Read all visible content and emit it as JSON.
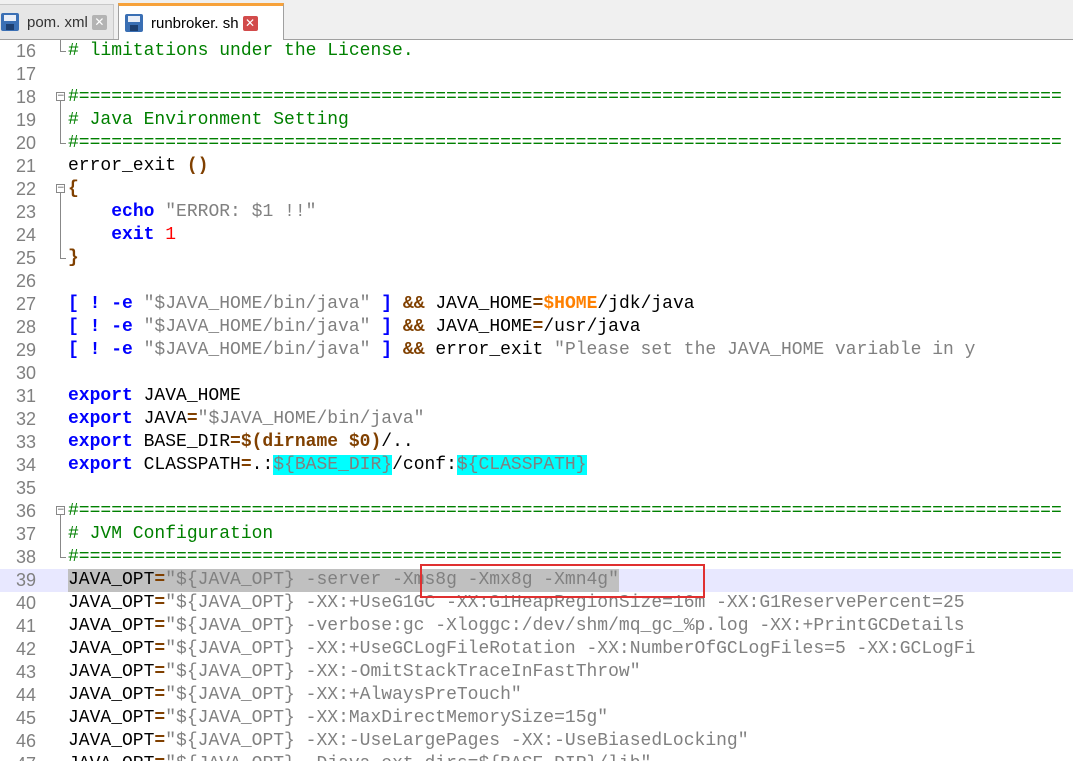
{
  "tabs": [
    {
      "label": "pom. xml",
      "close": "✕",
      "active": false
    },
    {
      "label": "runbroker. sh",
      "close": "✕",
      "active": true
    }
  ],
  "lines": [
    {
      "n": "16",
      "fold": "end",
      "segs": [
        {
          "t": "# limitations under the License.",
          "c": "c-com"
        }
      ]
    },
    {
      "n": "17",
      "fold": "",
      "segs": []
    },
    {
      "n": "18",
      "fold": "start",
      "segs": [
        {
          "t": "#===========================================================================================",
          "c": "c-com"
        }
      ]
    },
    {
      "n": "19",
      "fold": "mid",
      "segs": [
        {
          "t": "# Java Environment Setting",
          "c": "c-com"
        }
      ]
    },
    {
      "n": "20",
      "fold": "end",
      "segs": [
        {
          "t": "#===========================================================================================",
          "c": "c-com"
        }
      ]
    },
    {
      "n": "21",
      "fold": "",
      "segs": [
        {
          "t": "error_exit ",
          "c": "c-plain"
        },
        {
          "t": "()",
          "c": "c-op"
        }
      ]
    },
    {
      "n": "22",
      "fold": "start",
      "segs": [
        {
          "t": "{",
          "c": "c-op"
        }
      ]
    },
    {
      "n": "23",
      "fold": "mid",
      "segs": [
        {
          "t": "    ",
          "c": "c-plain"
        },
        {
          "t": "echo",
          "c": "c-kw"
        },
        {
          "t": " ",
          "c": "c-plain"
        },
        {
          "t": "\"ERROR: $1 !!\"",
          "c": "c-str"
        }
      ]
    },
    {
      "n": "24",
      "fold": "mid",
      "segs": [
        {
          "t": "    ",
          "c": "c-plain"
        },
        {
          "t": "exit",
          "c": "c-kw"
        },
        {
          "t": " ",
          "c": "c-plain"
        },
        {
          "t": "1",
          "c": "c-num"
        }
      ]
    },
    {
      "n": "25",
      "fold": "end",
      "segs": [
        {
          "t": "}",
          "c": "c-op"
        }
      ]
    },
    {
      "n": "26",
      "fold": "",
      "segs": []
    },
    {
      "n": "27",
      "fold": "",
      "segs": [
        {
          "t": "[ ! -e",
          "c": "c-kw"
        },
        {
          "t": " ",
          "c": "c-plain"
        },
        {
          "t": "\"$JAVA_HOME/bin/java\"",
          "c": "c-str"
        },
        {
          "t": " ",
          "c": "c-plain"
        },
        {
          "t": "]",
          "c": "c-kw"
        },
        {
          "t": " ",
          "c": "c-plain"
        },
        {
          "t": "&&",
          "c": "c-op"
        },
        {
          "t": " JAVA_HOME",
          "c": "c-plain"
        },
        {
          "t": "=",
          "c": "c-op"
        },
        {
          "t": "$HOME",
          "c": "c-var"
        },
        {
          "t": "/jdk/java",
          "c": "c-plain"
        }
      ]
    },
    {
      "n": "28",
      "fold": "",
      "segs": [
        {
          "t": "[ ! -e",
          "c": "c-kw"
        },
        {
          "t": " ",
          "c": "c-plain"
        },
        {
          "t": "\"$JAVA_HOME/bin/java\"",
          "c": "c-str"
        },
        {
          "t": " ",
          "c": "c-plain"
        },
        {
          "t": "]",
          "c": "c-kw"
        },
        {
          "t": " ",
          "c": "c-plain"
        },
        {
          "t": "&&",
          "c": "c-op"
        },
        {
          "t": " JAVA_HOME",
          "c": "c-plain"
        },
        {
          "t": "=",
          "c": "c-op"
        },
        {
          "t": "/usr/java",
          "c": "c-plain"
        }
      ]
    },
    {
      "n": "29",
      "fold": "",
      "segs": [
        {
          "t": "[ ! -e",
          "c": "c-kw"
        },
        {
          "t": " ",
          "c": "c-plain"
        },
        {
          "t": "\"$JAVA_HOME/bin/java\"",
          "c": "c-str"
        },
        {
          "t": " ",
          "c": "c-plain"
        },
        {
          "t": "]",
          "c": "c-kw"
        },
        {
          "t": " ",
          "c": "c-plain"
        },
        {
          "t": "&&",
          "c": "c-op"
        },
        {
          "t": " error_exit ",
          "c": "c-plain"
        },
        {
          "t": "\"Please set the JAVA_HOME variable in y",
          "c": "c-str"
        }
      ]
    },
    {
      "n": "30",
      "fold": "",
      "segs": []
    },
    {
      "n": "31",
      "fold": "",
      "segs": [
        {
          "t": "export",
          "c": "c-kw"
        },
        {
          "t": " JAVA_HOME",
          "c": "c-plain"
        }
      ]
    },
    {
      "n": "32",
      "fold": "",
      "segs": [
        {
          "t": "export",
          "c": "c-kw"
        },
        {
          "t": " JAVA",
          "c": "c-plain"
        },
        {
          "t": "=",
          "c": "c-op"
        },
        {
          "t": "\"$JAVA_HOME/bin/java\"",
          "c": "c-str"
        }
      ]
    },
    {
      "n": "33",
      "fold": "",
      "segs": [
        {
          "t": "export",
          "c": "c-kw"
        },
        {
          "t": " BASE_DIR",
          "c": "c-plain"
        },
        {
          "t": "=$(dirname $0)",
          "c": "c-op"
        },
        {
          "t": "/..",
          "c": "c-plain"
        }
      ]
    },
    {
      "n": "34",
      "fold": "",
      "segs": [
        {
          "t": "export",
          "c": "c-kw"
        },
        {
          "t": " CLASSPATH",
          "c": "c-plain"
        },
        {
          "t": "=",
          "c": "c-op"
        },
        {
          "t": ".:",
          "c": "c-plain"
        },
        {
          "t": "${BASE_DIR}",
          "c": "c-hl"
        },
        {
          "t": "/conf:",
          "c": "c-plain"
        },
        {
          "t": "${CLASSPATH}",
          "c": "c-hl"
        }
      ]
    },
    {
      "n": "35",
      "fold": "",
      "segs": []
    },
    {
      "n": "36",
      "fold": "start",
      "segs": [
        {
          "t": "#===========================================================================================",
          "c": "c-com"
        }
      ]
    },
    {
      "n": "37",
      "fold": "mid",
      "segs": [
        {
          "t": "# JVM Configuration",
          "c": "c-com"
        }
      ]
    },
    {
      "n": "38",
      "fold": "end",
      "segs": [
        {
          "t": "#===========================================================================================",
          "c": "c-com"
        }
      ]
    },
    {
      "n": "39",
      "fold": "",
      "sel": true,
      "segs": [
        {
          "t": "JAVA_OPT",
          "c": "c-plain"
        },
        {
          "t": "=",
          "c": "c-op"
        },
        {
          "t": "\"${JAVA_OPT} -server -Xms8g -Xmx8g -Xmn4g\"",
          "c": "c-str"
        }
      ]
    },
    {
      "n": "40",
      "fold": "",
      "segs": [
        {
          "t": "JAVA_OPT",
          "c": "c-plain"
        },
        {
          "t": "=",
          "c": "c-op"
        },
        {
          "t": "\"${JAVA_OPT} -XX:+UseG1GC -XX:G1HeapRegionSize=16m -XX:G1ReservePercent=25",
          "c": "c-str"
        }
      ]
    },
    {
      "n": "41",
      "fold": "",
      "segs": [
        {
          "t": "JAVA_OPT",
          "c": "c-plain"
        },
        {
          "t": "=",
          "c": "c-op"
        },
        {
          "t": "\"${JAVA_OPT} -verbose:gc -Xloggc:/dev/shm/mq_gc_%p.log -XX:+PrintGCDetails",
          "c": "c-str"
        }
      ]
    },
    {
      "n": "42",
      "fold": "",
      "segs": [
        {
          "t": "JAVA_OPT",
          "c": "c-plain"
        },
        {
          "t": "=",
          "c": "c-op"
        },
        {
          "t": "\"${JAVA_OPT} -XX:+UseGCLogFileRotation -XX:NumberOfGCLogFiles=5 -XX:GCLogFi",
          "c": "c-str"
        }
      ]
    },
    {
      "n": "43",
      "fold": "",
      "segs": [
        {
          "t": "JAVA_OPT",
          "c": "c-plain"
        },
        {
          "t": "=",
          "c": "c-op"
        },
        {
          "t": "\"${JAVA_OPT} -XX:-OmitStackTraceInFastThrow\"",
          "c": "c-str"
        }
      ]
    },
    {
      "n": "44",
      "fold": "",
      "segs": [
        {
          "t": "JAVA_OPT",
          "c": "c-plain"
        },
        {
          "t": "=",
          "c": "c-op"
        },
        {
          "t": "\"${JAVA_OPT} -XX:+AlwaysPreTouch\"",
          "c": "c-str"
        }
      ]
    },
    {
      "n": "45",
      "fold": "",
      "segs": [
        {
          "t": "JAVA_OPT",
          "c": "c-plain"
        },
        {
          "t": "=",
          "c": "c-op"
        },
        {
          "t": "\"${JAVA_OPT} -XX:MaxDirectMemorySize=15g\"",
          "c": "c-str"
        }
      ]
    },
    {
      "n": "46",
      "fold": "",
      "segs": [
        {
          "t": "JAVA_OPT",
          "c": "c-plain"
        },
        {
          "t": "=",
          "c": "c-op"
        },
        {
          "t": "\"${JAVA_OPT} -XX:-UseLargePages -XX:-UseBiasedLocking\"",
          "c": "c-str"
        }
      ]
    },
    {
      "n": "47",
      "fold": "",
      "segs": [
        {
          "t": "JAVA_OPT",
          "c": "c-plain"
        },
        {
          "t": "=",
          "c": "c-op"
        },
        {
          "t": "\"${JAVA_OPT} -Djava.ext.dirs=${BASE_DIR}/lib\"",
          "c": "c-str"
        }
      ]
    }
  ]
}
